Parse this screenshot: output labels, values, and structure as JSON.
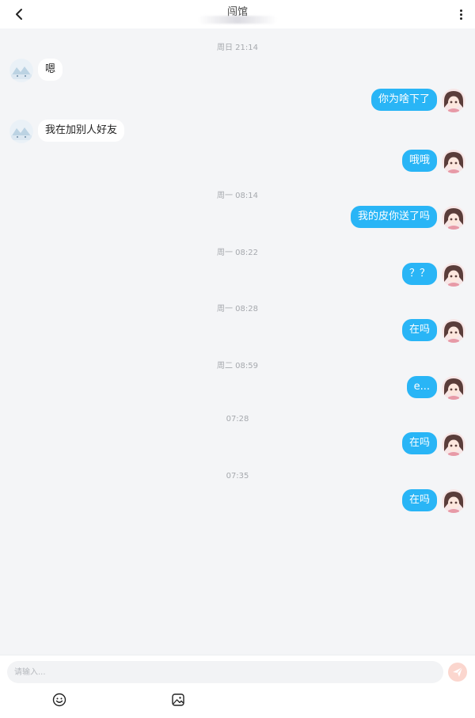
{
  "header": {
    "title": "闯馆",
    "back_icon": "chevron-left-icon",
    "more_icon": "more-vertical-icon"
  },
  "messages": [
    {
      "type": "time",
      "text": "周日 21:14"
    },
    {
      "type": "in",
      "text": "嗯"
    },
    {
      "type": "out",
      "text": "你为啥下了"
    },
    {
      "type": "in",
      "text": "我在加别人好友"
    },
    {
      "type": "out",
      "text": "哦哦"
    },
    {
      "type": "time",
      "text": "周一 08:14"
    },
    {
      "type": "out",
      "text": "我的皮你送了吗"
    },
    {
      "type": "time",
      "text": "周一 08:22"
    },
    {
      "type": "out",
      "text": "？？"
    },
    {
      "type": "time",
      "text": "周一 08:28"
    },
    {
      "type": "out",
      "text": "在吗"
    },
    {
      "type": "time",
      "text": "周二 08:59"
    },
    {
      "type": "out",
      "text": "e..."
    },
    {
      "type": "time",
      "text": "07:28"
    },
    {
      "type": "out",
      "text": "在吗"
    },
    {
      "type": "time",
      "text": "07:35"
    },
    {
      "type": "out",
      "text": "在吗"
    }
  ],
  "input": {
    "placeholder": "请输入...",
    "send_icon": "send-icon",
    "emoji_icon": "emoji-icon",
    "image_icon": "image-icon"
  },
  "colors": {
    "outgoing_bubble": "#29b5f6",
    "incoming_bubble": "#ffffff",
    "background": "#f4f5f7",
    "send_button": "#fbd6ce"
  }
}
